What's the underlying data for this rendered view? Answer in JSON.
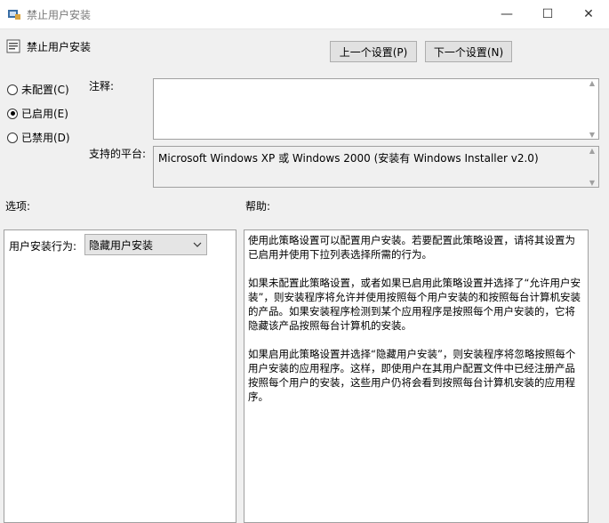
{
  "window": {
    "title": "禁止用户安装",
    "minimize_glyph": "—",
    "maximize_glyph": "☐",
    "close_glyph": "✕"
  },
  "header": {
    "title": "禁止用户安装",
    "prev_button": "上一个设置(P)",
    "next_button": "下一个设置(N)"
  },
  "state": {
    "options": [
      {
        "label": "未配置(C)",
        "checked": false
      },
      {
        "label": "已启用(E)",
        "checked": true
      },
      {
        "label": "已禁用(D)",
        "checked": false
      }
    ]
  },
  "comment": {
    "label": "注释:",
    "value": ""
  },
  "platform": {
    "label": "支持的平台:",
    "value": "Microsoft Windows XP 或 Windows 2000 (安装有 Windows Installer v2.0)"
  },
  "options_panel": {
    "heading": "选项:",
    "field_label": "用户安装行为:",
    "selected_value": "隐藏用户安装"
  },
  "help_panel": {
    "heading": "帮助:",
    "paragraphs": [
      "使用此策略设置可以配置用户安装。若要配置此策略设置，请将其设置为已启用并使用下拉列表选择所需的行为。",
      "如果未配置此策略设置，或者如果已启用此策略设置并选择了“允许用户安装”，则安装程序将允许并使用按照每个用户安装的和按照每台计算机安装的产品。如果安装程序检测到某个应用程序是按照每个用户安装的，它将隐藏该产品按照每台计算机的安装。",
      "如果启用此策略设置并选择“隐藏用户安装”，则安装程序将忽略按照每个用户安装的应用程序。这样，即使用户在其用户配置文件中已经注册产品按照每个用户的安装，这些用户仍将会看到按照每台计算机安装的应用程序。"
    ]
  },
  "icons": {
    "title_icon": "policy-icon",
    "header_icon": "setting-icon"
  }
}
